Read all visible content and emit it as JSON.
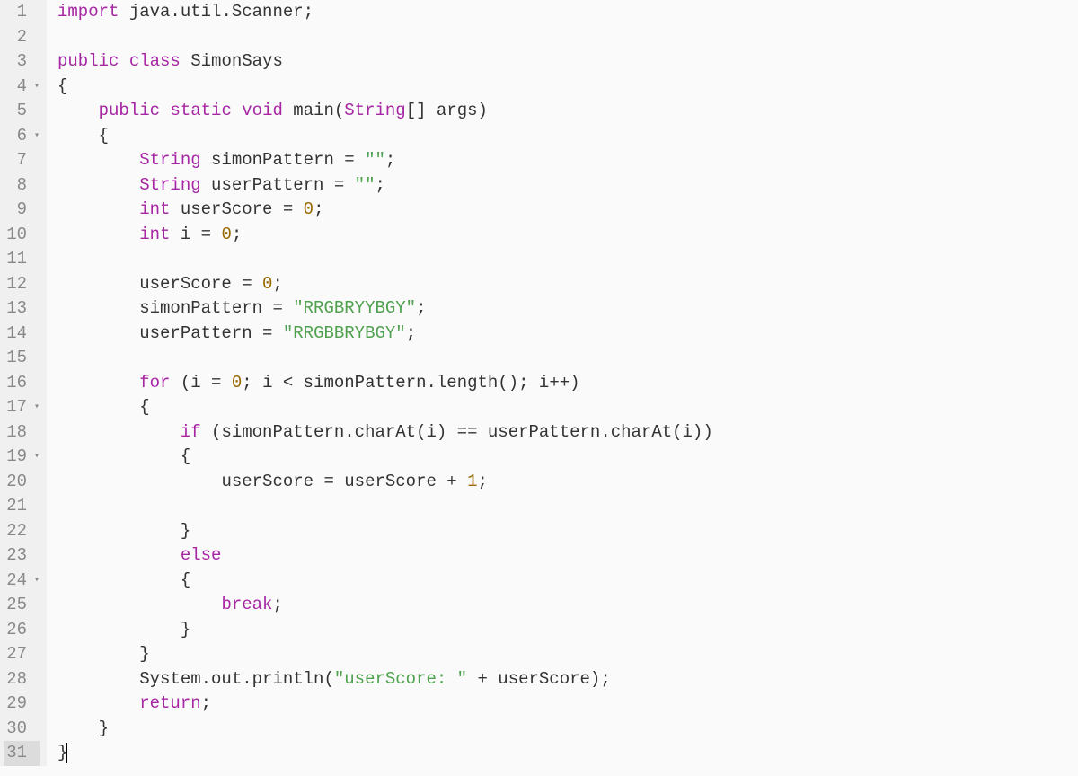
{
  "lines": [
    {
      "num": "1",
      "fold": false,
      "highlighted": false
    },
    {
      "num": "2",
      "fold": false,
      "highlighted": false
    },
    {
      "num": "3",
      "fold": false,
      "highlighted": false
    },
    {
      "num": "4",
      "fold": true,
      "highlighted": false
    },
    {
      "num": "5",
      "fold": false,
      "highlighted": false
    },
    {
      "num": "6",
      "fold": true,
      "highlighted": false
    },
    {
      "num": "7",
      "fold": false,
      "highlighted": false
    },
    {
      "num": "8",
      "fold": false,
      "highlighted": false
    },
    {
      "num": "9",
      "fold": false,
      "highlighted": false
    },
    {
      "num": "10",
      "fold": false,
      "highlighted": false
    },
    {
      "num": "11",
      "fold": false,
      "highlighted": false
    },
    {
      "num": "12",
      "fold": false,
      "highlighted": false
    },
    {
      "num": "13",
      "fold": false,
      "highlighted": false
    },
    {
      "num": "14",
      "fold": false,
      "highlighted": false
    },
    {
      "num": "15",
      "fold": false,
      "highlighted": false
    },
    {
      "num": "16",
      "fold": false,
      "highlighted": false
    },
    {
      "num": "17",
      "fold": true,
      "highlighted": false
    },
    {
      "num": "18",
      "fold": false,
      "highlighted": false
    },
    {
      "num": "19",
      "fold": true,
      "highlighted": false
    },
    {
      "num": "20",
      "fold": false,
      "highlighted": false
    },
    {
      "num": "21",
      "fold": false,
      "highlighted": false
    },
    {
      "num": "22",
      "fold": false,
      "highlighted": false
    },
    {
      "num": "23",
      "fold": false,
      "highlighted": false
    },
    {
      "num": "24",
      "fold": true,
      "highlighted": false
    },
    {
      "num": "25",
      "fold": false,
      "highlighted": false
    },
    {
      "num": "26",
      "fold": false,
      "highlighted": false
    },
    {
      "num": "27",
      "fold": false,
      "highlighted": false
    },
    {
      "num": "28",
      "fold": false,
      "highlighted": false
    },
    {
      "num": "29",
      "fold": false,
      "highlighted": false
    },
    {
      "num": "30",
      "fold": false,
      "highlighted": false
    },
    {
      "num": "31",
      "fold": false,
      "highlighted": true
    }
  ],
  "code": {
    "l1": {
      "import": "import",
      "pkg": " java.util.Scanner;"
    },
    "l3": {
      "public": "public",
      "class": "class",
      "name": " SimonSays"
    },
    "l4": {
      "brace": "{"
    },
    "l5": {
      "public": "public",
      "static": "static",
      "void": "void",
      "main": " main(",
      "string": "String",
      "rest": "[] args)"
    },
    "l6": {
      "brace": "{"
    },
    "l7": {
      "type": "String",
      "rest": " simonPattern = ",
      "str": "\"\"",
      "semi": ";"
    },
    "l8": {
      "type": "String",
      "rest": " userPattern = ",
      "str": "\"\"",
      "semi": ";"
    },
    "l9": {
      "type": "int",
      "rest": " userScore = ",
      "num": "0",
      "semi": ";"
    },
    "l10": {
      "type": "int",
      "rest": " i = ",
      "num": "0",
      "semi": ";"
    },
    "l12": {
      "rest": "userScore = ",
      "num": "0",
      "semi": ";"
    },
    "l13": {
      "rest": "simonPattern = ",
      "str": "\"RRGBRYYBGY\"",
      "semi": ";"
    },
    "l14": {
      "rest": "userPattern = ",
      "str": "\"RRGBBRYBGY\"",
      "semi": ";"
    },
    "l16": {
      "for": "for",
      "p1": " (i = ",
      "n1": "0",
      "p2": "; i < simonPattern.length(); i++)"
    },
    "l17": {
      "brace": "{"
    },
    "l18": {
      "if": "if",
      "rest": " (simonPattern.charAt(i) == userPattern.charAt(i))"
    },
    "l19": {
      "brace": "{"
    },
    "l20": {
      "rest": "userScore = userScore + ",
      "num": "1",
      "semi": ";"
    },
    "l22": {
      "brace": "}"
    },
    "l23": {
      "else": "else"
    },
    "l24": {
      "brace": "{"
    },
    "l25": {
      "break": "break",
      "semi": ";"
    },
    "l26": {
      "brace": "}"
    },
    "l27": {
      "brace": "}"
    },
    "l28": {
      "p1": "System.out.println(",
      "str": "\"userScore: \"",
      "p2": " + userScore);"
    },
    "l29": {
      "return": "return",
      "semi": ";"
    },
    "l30": {
      "brace": "}"
    },
    "l31": {
      "brace": "}"
    }
  },
  "foldGlyph": "▾"
}
